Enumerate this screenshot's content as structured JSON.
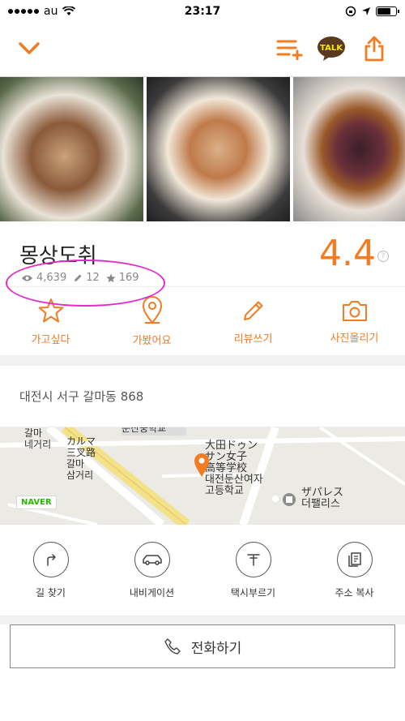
{
  "status": {
    "carrier": "au",
    "time": "23:17",
    "battery_level": 0.75
  },
  "restaurant": {
    "name": "몽상도취",
    "rating": "4.4",
    "views": "4,639",
    "reviews": "12",
    "favorites": "169",
    "rating_help": "?"
  },
  "actions": [
    {
      "label": "가고싶다",
      "icon": "star-outline-icon"
    },
    {
      "label": "가봤어요",
      "icon": "location-pin-icon"
    },
    {
      "label": "리뷰쓰기",
      "icon": "pencil-icon"
    },
    {
      "label": "사진올리기",
      "icon": "camera-icon"
    }
  ],
  "address": "대전시 서구 갈마동 868",
  "map": {
    "labels": [
      "갈마",
      "네거리",
      "カルマ",
      "三叉路",
      "갈마",
      "삼거리",
      "둔산중학교",
      "大田ドゥン",
      "サン女子",
      "高等学校",
      "대전둔산여자",
      "고등학교",
      "ザパレス",
      "더팰리스"
    ],
    "provider": "NAVER"
  },
  "navigation": [
    {
      "label": "길 찾기",
      "icon": "turn-arrow-icon"
    },
    {
      "label": "내비게이션",
      "icon": "car-icon"
    },
    {
      "label": "택시부르기",
      "icon": "taxi-icon"
    },
    {
      "label": "주소 복사",
      "icon": "copy-icon"
    }
  ],
  "call_label": "전화하기",
  "colors": {
    "accent": "#f37b22",
    "highlight": "#e62bc9",
    "naver_green": "#2db400"
  }
}
